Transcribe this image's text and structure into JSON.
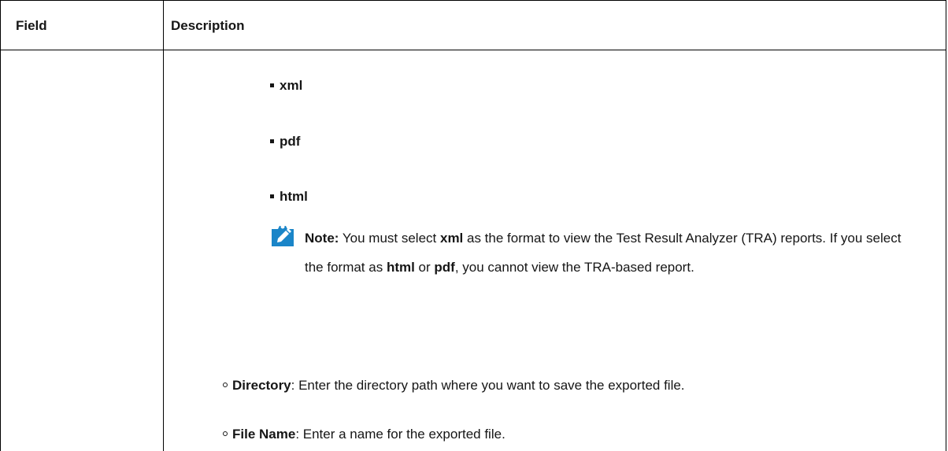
{
  "table": {
    "header": {
      "col1": "Field",
      "col2": "Description"
    }
  },
  "formats": [
    {
      "label": "xml"
    },
    {
      "label": "pdf"
    },
    {
      "label": "html"
    }
  ],
  "note": {
    "icon": "pencil-note-icon",
    "accent_color": "#1a85c8",
    "prefix": "Note:",
    "t1": " You must select ",
    "b1": "xml",
    "t2": " as the format to view the Test Result Analyzer (TRA) reports. If you select the format as ",
    "b2": "html",
    "t3": " or ",
    "b3": "pdf",
    "t4": ", you cannot view the TRA-based report."
  },
  "options": [
    {
      "label": "Directory",
      "text": ": Enter the directory path where you want to save the exported file."
    },
    {
      "label": "File Name",
      "text": ": Enter a name for the exported file."
    }
  ]
}
